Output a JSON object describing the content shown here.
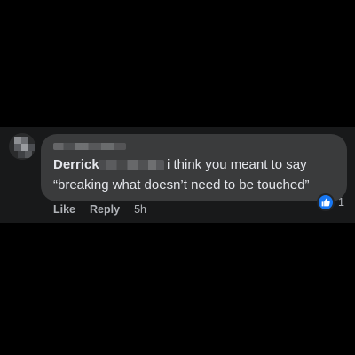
{
  "comment": {
    "author": "Derrick",
    "text_line1": "i think you meant to say",
    "text_line2": "“breaking what doesn’t need to be touched”",
    "actions": {
      "like_label": "Like",
      "reply_label": "Reply",
      "timestamp": "5h"
    },
    "reaction": {
      "icon": "thumbs-up-icon",
      "count": "1",
      "color": "#1877f2"
    }
  },
  "theme": {
    "background": "#000000",
    "panel": "#18191a",
    "bubble": "#3a3b3c",
    "text_primary": "#e4e6eb",
    "text_secondary": "#b0b3b8"
  }
}
